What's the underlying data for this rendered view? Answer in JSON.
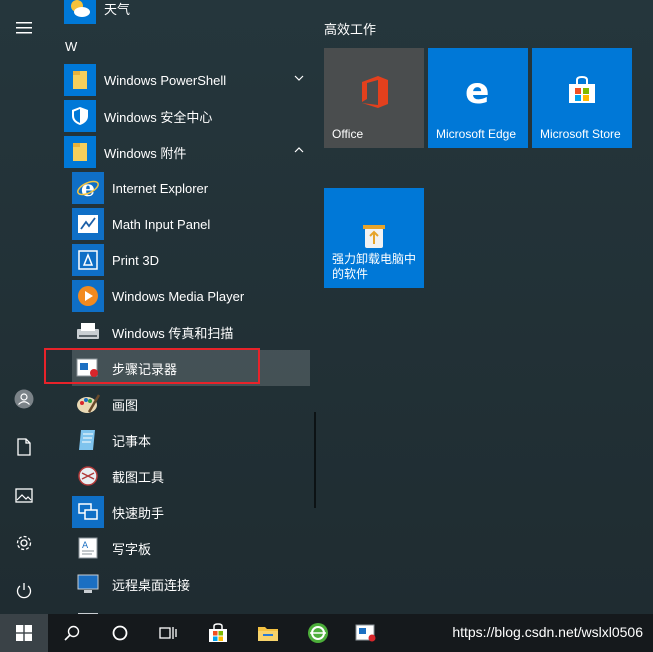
{
  "rail": {
    "menu_icon": "hamburger-icon",
    "items": [
      "user-icon",
      "document-icon",
      "pictures-icon",
      "settings-icon",
      "power-icon"
    ]
  },
  "app_list": {
    "weather_label": "天气",
    "group_letter": "W",
    "folders": {
      "powershell": "Windows PowerShell",
      "security": "Windows 安全中心",
      "accessories": "Windows 附件"
    },
    "accessories_items": [
      "Internet Explorer",
      "Math Input Panel",
      "Print 3D",
      "Windows Media Player",
      "Windows 传真和扫描",
      "步骤记录器",
      "画图",
      "记事本",
      "截图工具",
      "快速助手",
      "写字板",
      "远程桌面连接"
    ],
    "highlighted_item": "步骤记录器"
  },
  "tiles": {
    "header": "高效工作",
    "items": [
      {
        "label": "Office",
        "color": "#4a4d4e"
      },
      {
        "label": "Microsoft Edge",
        "color": "#0078d7"
      },
      {
        "label": "Microsoft Store",
        "color": "#0078d7"
      },
      {
        "label": "强力卸载电脑中的软件",
        "color": "#0078d7"
      }
    ]
  },
  "taskbar": {
    "buttons": [
      "windows-start-icon",
      "search-icon",
      "cortana-icon",
      "task-view-icon",
      "store-icon",
      "file-explorer-icon",
      "browser-icon",
      "steps-recorder-icon"
    ],
    "watermark": "https://blog.csdn.net/wslxl0506"
  },
  "colors": {
    "accent": "#0078d7",
    "highlight_border": "#e8232a"
  }
}
